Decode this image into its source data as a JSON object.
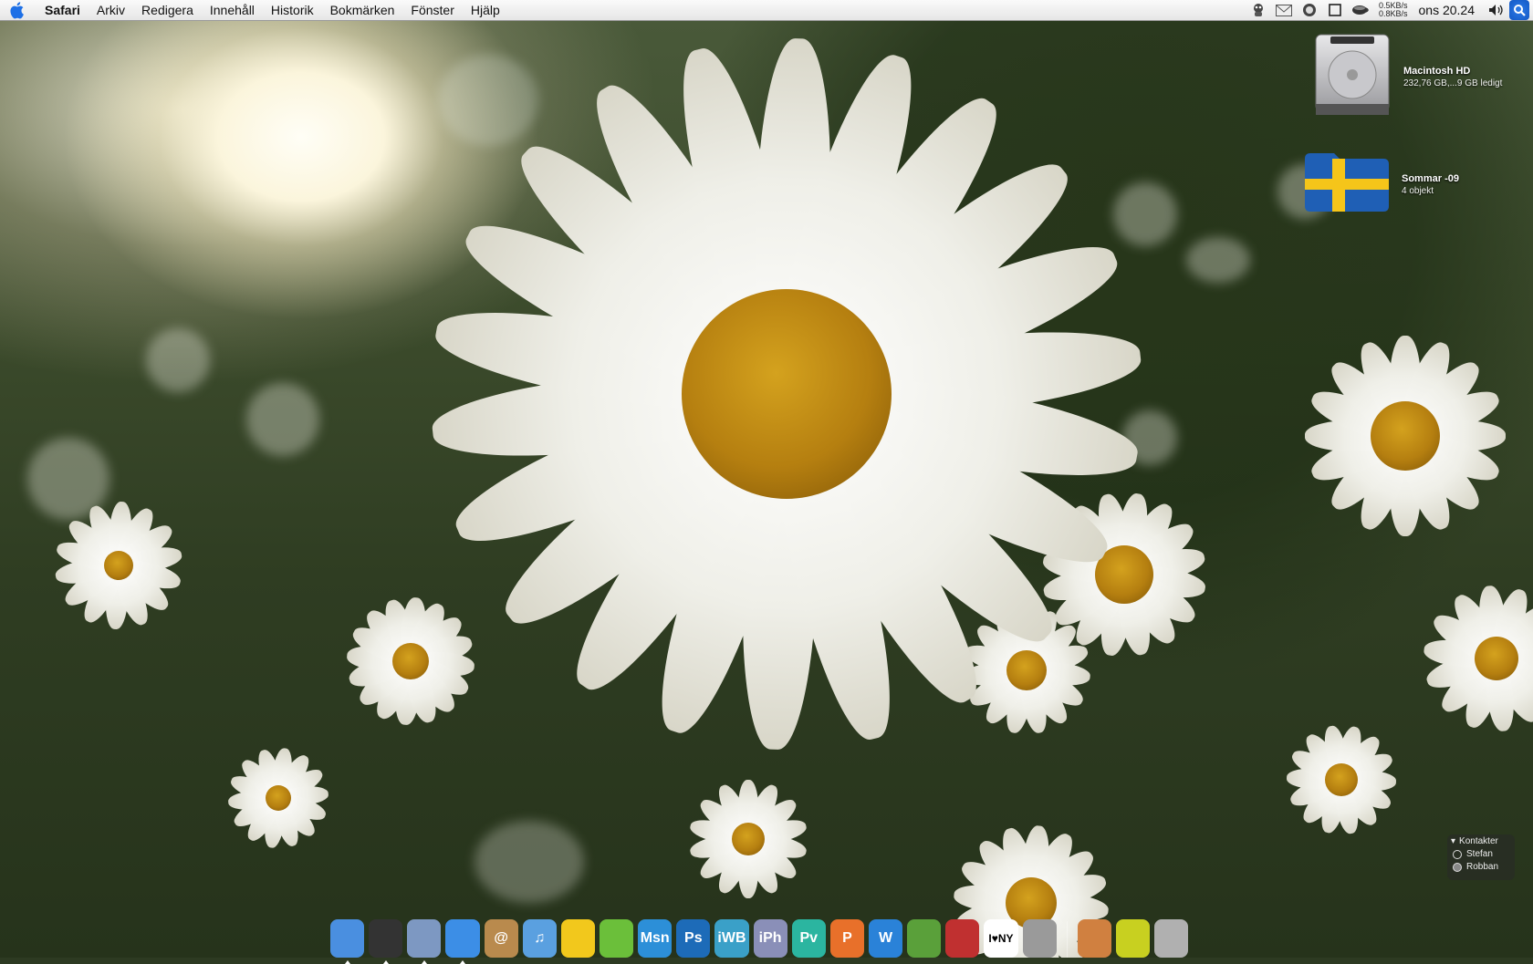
{
  "menubar": {
    "apple_icon": "apple-logo-icon",
    "app_name": "Safari",
    "menus": [
      "Arkiv",
      "Redigera",
      "Innehåll",
      "Historik",
      "Bokmärken",
      "Fönster",
      "Hjälp"
    ],
    "net_up": "0.5KB/s",
    "net_down": "0.8KB/s",
    "clock": "ons 20.24",
    "status_icons": [
      "adium-icon",
      "mail-icon",
      "istat-icon",
      "window-icon",
      "coffee-cup-icon",
      "volume-icon",
      "spotlight-icon"
    ]
  },
  "desktop": {
    "hd": {
      "name": "Macintosh HD",
      "info": "232,76 GB,...9 GB ledigt"
    },
    "folder": {
      "name": "Sommar -09",
      "info": "4 objekt"
    }
  },
  "contacts": {
    "title": "Kontakter",
    "people": [
      "Stefan",
      "Robban"
    ]
  },
  "dock": {
    "items": [
      {
        "name": "finder",
        "label": "",
        "color": "#4a8fe0",
        "running": true
      },
      {
        "name": "dashboard",
        "label": "",
        "color": "#333333",
        "running": true
      },
      {
        "name": "mail",
        "label": "",
        "color": "#7d98c2",
        "running": true
      },
      {
        "name": "safari",
        "label": "",
        "color": "#3c8ee6",
        "running": true
      },
      {
        "name": "address-book",
        "label": "@",
        "color": "#b98a4d",
        "running": false
      },
      {
        "name": "itunes",
        "label": "♫",
        "color": "#5aa0e0",
        "running": false
      },
      {
        "name": "cyberduck",
        "label": "",
        "color": "#f2c81c",
        "running": false
      },
      {
        "name": "spotify",
        "label": "",
        "color": "#6bbf3a",
        "running": false
      },
      {
        "name": "msn",
        "label": "Msn",
        "color": "#2c8fd8",
        "running": false
      },
      {
        "name": "photoshop",
        "label": "Ps",
        "color": "#1d6bb8",
        "running": false
      },
      {
        "name": "iweb",
        "label": "iWB",
        "color": "#3aa0c8",
        "running": false
      },
      {
        "name": "iphoto",
        "label": "iPh",
        "color": "#8a8fb8",
        "running": false
      },
      {
        "name": "preview",
        "label": "Pv",
        "color": "#2bb5a0",
        "running": false
      },
      {
        "name": "pages",
        "label": "P",
        "color": "#e8702a",
        "running": false
      },
      {
        "name": "wordpress",
        "label": "W",
        "color": "#2a82d8",
        "running": false
      },
      {
        "name": "filezilla",
        "label": "",
        "color": "#5aa03a",
        "running": false
      },
      {
        "name": "instruments",
        "label": "",
        "color": "#c03030",
        "running": false
      },
      {
        "name": "i-love-ny",
        "label": "I♥NY",
        "color": "#000000",
        "running": false
      },
      {
        "name": "system-preferences",
        "label": "",
        "color": "#9a9a9a",
        "running": false
      },
      {
        "name": "applications-folder",
        "label": "",
        "color": "#d08040",
        "running": false
      },
      {
        "name": "downloads",
        "label": "",
        "color": "#c8d020",
        "running": false
      },
      {
        "name": "trash",
        "label": "",
        "color": "#b0b0b0",
        "running": false
      }
    ]
  }
}
